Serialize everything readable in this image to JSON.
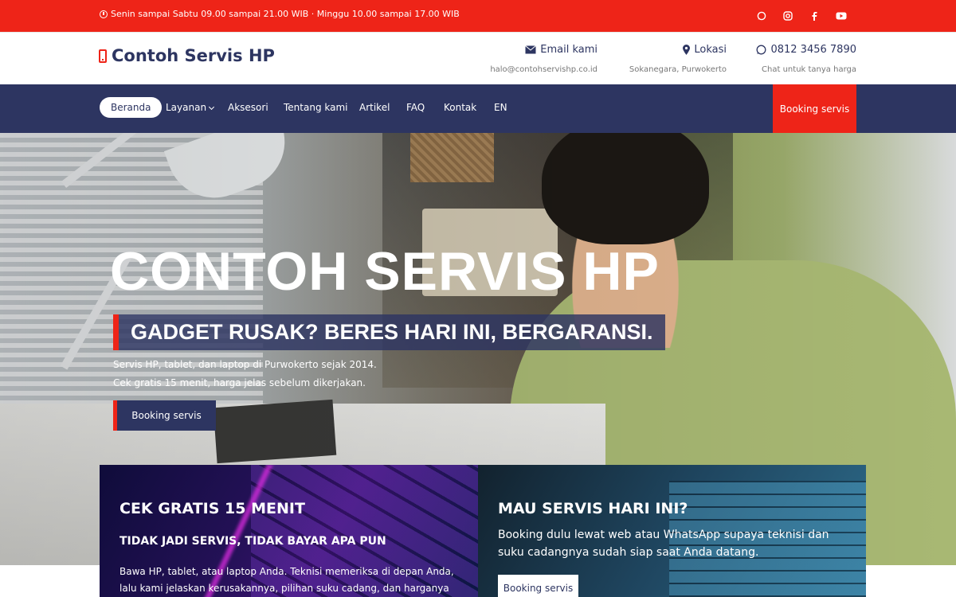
{
  "colors": {
    "accent_red": "#ee2418",
    "navy": "#2d3561"
  },
  "topbar": {
    "hours": "Senin sampai Sabtu 09.00 sampai 21.00 WIB · Minggu 10.00 sampai 17.00 WIB",
    "social_icons": [
      "whatsapp-icon",
      "instagram-icon",
      "facebook-icon",
      "youtube-icon"
    ]
  },
  "header": {
    "brand": "Contoh Servis HP",
    "email": {
      "title": "Email kami",
      "value": "halo@contohservishp.co.id"
    },
    "location": {
      "title": "Lokasi",
      "value": "Sokanegara, Purwokerto"
    },
    "phone": {
      "title": "0812 3456 7890",
      "value": "Chat untuk tanya harga"
    }
  },
  "nav": {
    "items": [
      "Beranda",
      "Layanan",
      "Aksesori",
      "Tentang kami",
      "Artikel",
      "FAQ",
      "Kontak",
      "EN"
    ],
    "active": "Beranda",
    "booking": "Booking servis"
  },
  "hero": {
    "title": "CONTOH SERVIS HP",
    "tagline": "GADGET RUSAK? BERES HARI INI, BERGARANSI.",
    "line1": "Servis HP, tablet, dan laptop di Purwokerto sejak 2014.",
    "line2": "Cek gratis 15 menit, harga jelas sebelum dikerjakan.",
    "button": "Booking servis"
  },
  "cards": {
    "left": {
      "heading": "CEK GRATIS 15 MENIT",
      "subheading": "TIDAK JADI SERVIS, TIDAK BAYAR APA PUN",
      "body": "Bawa HP, tablet, atau laptop Anda. Teknisi memeriksa di depan Anda, lalu kami jelaskan kerusakannya, pilihan suku cadang, dan harganya sebelum ada"
    },
    "right": {
      "heading": "MAU SERVIS HARI INI?",
      "body": "Booking dulu lewat web atau WhatsApp supaya teknisi dan suku cadangnya sudah siap saat Anda datang.",
      "button": "Booking servis"
    }
  }
}
